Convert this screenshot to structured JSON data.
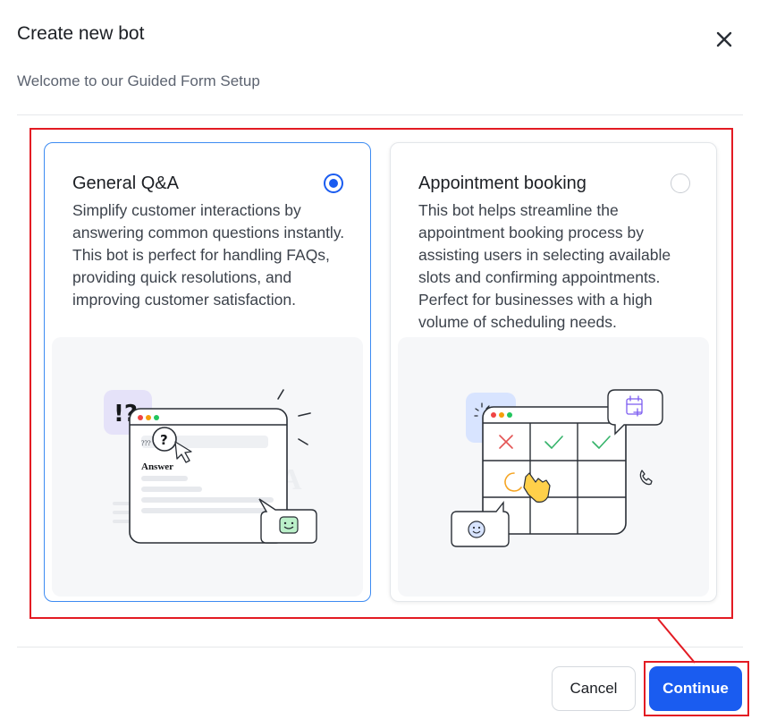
{
  "dialog": {
    "title": "Create new bot",
    "subtitle": "Welcome to our Guided Form Setup"
  },
  "options": [
    {
      "title": "General Q&A",
      "description": "Simplify customer interactions by answering common questions instantly. This bot is perfect for handling FAQs, providing quick resolutions, and improving customer satisfaction.",
      "selected": true,
      "illustration": {
        "badge_text": "!?",
        "question_mark": "?",
        "question_text": "???",
        "answer_text": "Answer",
        "watermark": "A"
      }
    },
    {
      "title": "Appointment booking",
      "description": "This bot helps streamline the appointment booking process by assisting users in selecting available slots and confirming appointments. Perfect for businesses with a high volume of scheduling needs.",
      "selected": false
    }
  ],
  "footer": {
    "cancel_label": "Cancel",
    "continue_label": "Continue"
  },
  "colors": {
    "accent": "#1a5cf0",
    "selected_border": "#3d8bf2",
    "annotation": "#e31b23"
  },
  "icons": [
    "close-icon",
    "radio-selected-icon",
    "radio-unselected-icon",
    "cursor-icon",
    "smiley-icon",
    "calendar-plus-icon",
    "hand-pointer-icon",
    "phone-icon",
    "check-icon",
    "cross-icon"
  ]
}
